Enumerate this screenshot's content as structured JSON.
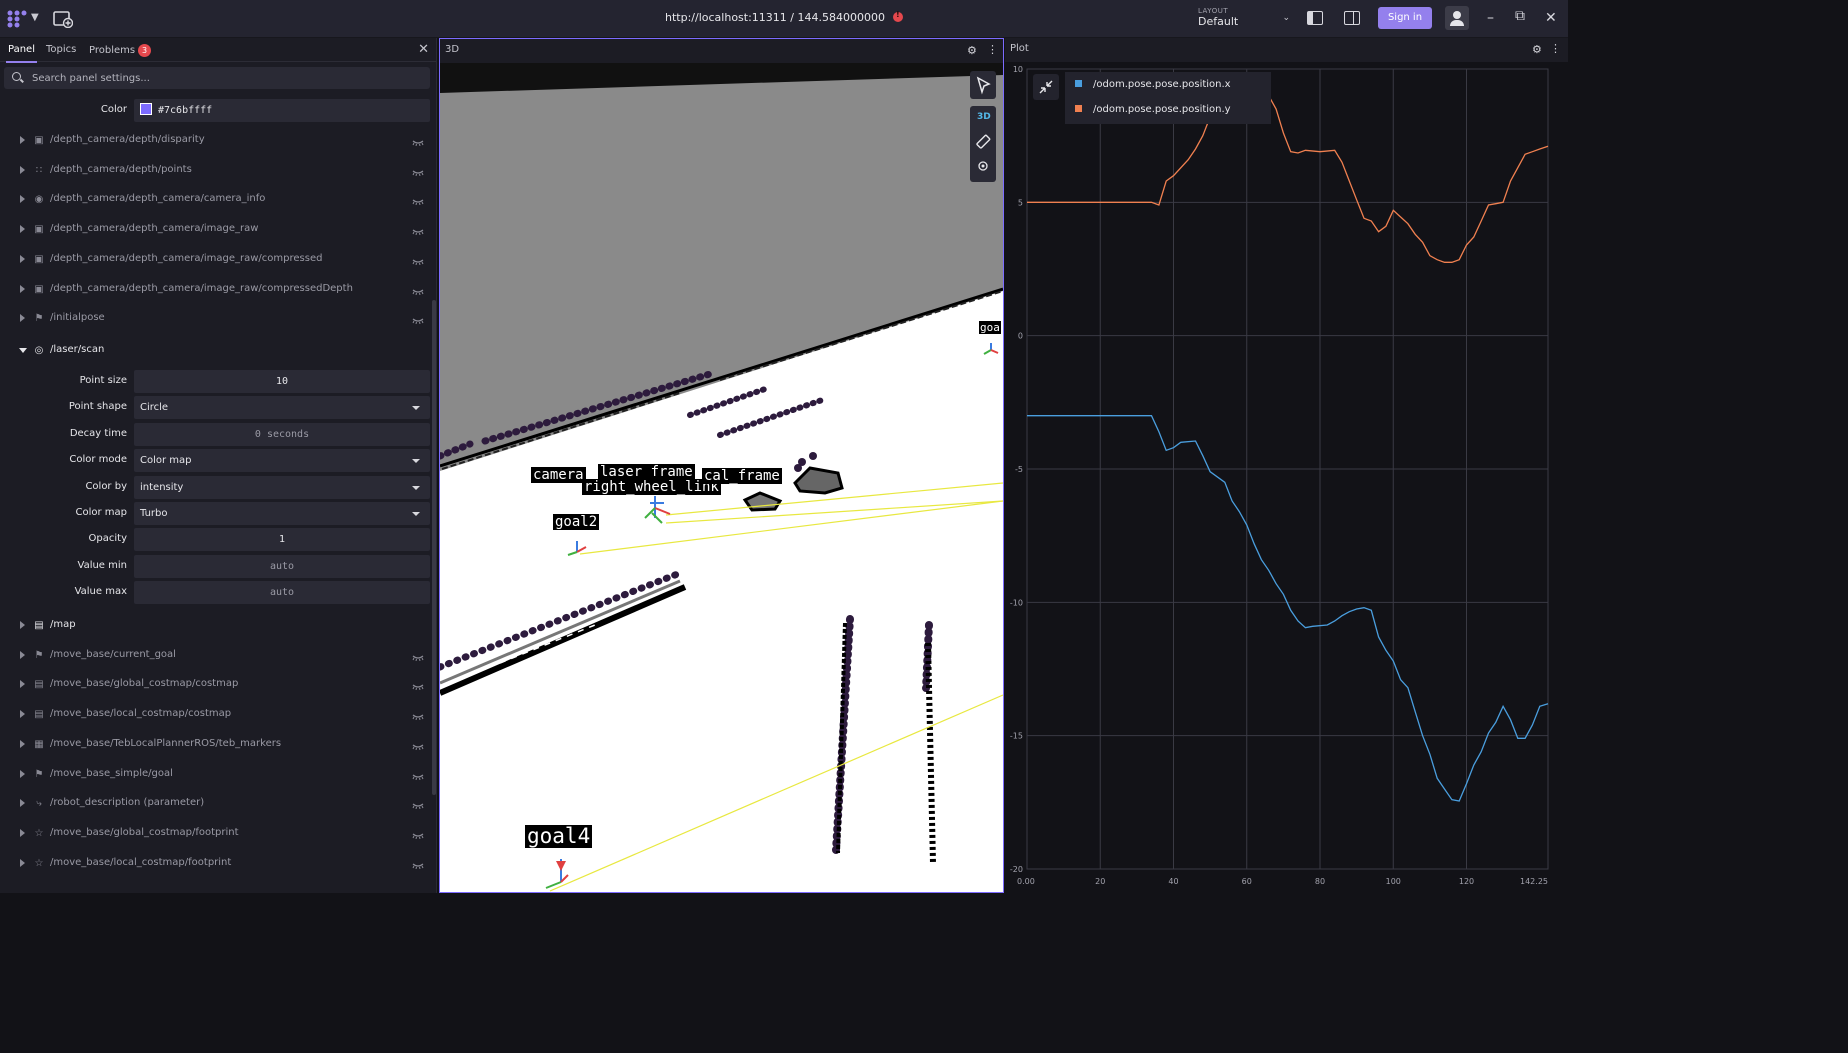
{
  "topbar": {
    "url": "http://localhost:11311 / 144.584000000",
    "layout_label": "LAYOUT",
    "layout_value": "Default",
    "signin": "Sign in"
  },
  "sidebar": {
    "tabs": [
      {
        "label": "Panel"
      },
      {
        "label": "Topics"
      },
      {
        "label": "Problems",
        "badge": "3"
      }
    ],
    "search_placeholder": "Search panel settings...",
    "color_field": {
      "label": "Color",
      "value": "#7c6bffff"
    },
    "topics_top": [
      {
        "name": "/depth_camera/depth/disparity",
        "icon": "image-icon"
      },
      {
        "name": "/depth_camera/depth/points",
        "icon": "points-icon"
      },
      {
        "name": "/depth_camera/depth_camera/camera_info",
        "icon": "camera-icon"
      },
      {
        "name": "/depth_camera/depth_camera/image_raw",
        "icon": "image-icon"
      },
      {
        "name": "/depth_camera/depth_camera/image_raw/compressed",
        "icon": "image-icon"
      },
      {
        "name": "/depth_camera/depth_camera/image_raw/compressedDepth",
        "icon": "image-icon"
      },
      {
        "name": "/initialpose",
        "icon": "flag-icon"
      }
    ],
    "laser": {
      "name": "/laser/scan",
      "fields": [
        {
          "label": "Point size",
          "value": "10",
          "kind": "number"
        },
        {
          "label": "Point shape",
          "value": "Circle",
          "kind": "select"
        },
        {
          "label": "Decay time",
          "value": "0 seconds",
          "kind": "muted"
        },
        {
          "label": "Color mode",
          "value": "Color map",
          "kind": "select"
        },
        {
          "label": "Color by",
          "value": "intensity",
          "kind": "select"
        },
        {
          "label": "Color map",
          "value": "Turbo",
          "kind": "select"
        },
        {
          "label": "Opacity",
          "value": "1",
          "kind": "number"
        },
        {
          "label": "Value min",
          "value": "auto",
          "kind": "muted"
        },
        {
          "label": "Value max",
          "value": "auto",
          "kind": "muted"
        }
      ]
    },
    "topics_bottom": [
      {
        "name": "/map",
        "icon": "grid-icon",
        "visible": true
      },
      {
        "name": "/move_base/current_goal",
        "icon": "flag-icon",
        "visible": false
      },
      {
        "name": "/move_base/global_costmap/costmap",
        "icon": "grid-icon",
        "visible": false
      },
      {
        "name": "/move_base/local_costmap/costmap",
        "icon": "grid-icon",
        "visible": false
      },
      {
        "name": "/move_base/TebLocalPlannerROS/teb_markers",
        "icon": "shapes-icon",
        "visible": false
      },
      {
        "name": "/move_base_simple/goal",
        "icon": "flag-icon",
        "visible": false
      },
      {
        "name": "/robot_description (parameter)",
        "icon": "robot-arm-icon",
        "visible": false
      },
      {
        "name": "/move_base/global_costmap/footprint",
        "icon": "star-icon",
        "visible": false
      },
      {
        "name": "/move_base/local_costmap/footprint",
        "icon": "star-icon",
        "visible": false
      }
    ]
  },
  "panel3d": {
    "title": "3D",
    "toolbar_3d_label": "3D",
    "labels": [
      "camera",
      "laser_frame",
      "right_wheel_link",
      "cal_frame",
      "goal2",
      "goal4",
      "goa"
    ]
  },
  "plot": {
    "title": "Plot",
    "legend": [
      {
        "name": "/odom.pose.pose.position.x",
        "color": "#4a9ede"
      },
      {
        "name": "/odom.pose.pose.position.y",
        "color": "#f08050"
      }
    ],
    "y_ticks": [
      "10",
      "5",
      "0",
      "-5",
      "-10",
      "-15",
      "-20"
    ],
    "x_ticks": [
      "0.00",
      "20",
      "40",
      "60",
      "80",
      "100",
      "120",
      "142.25"
    ]
  },
  "chart_data": {
    "type": "line",
    "xlim": [
      0,
      142.25
    ],
    "ylim": [
      -20,
      10
    ],
    "grid": true,
    "legend_position": "top-left",
    "series": [
      {
        "name": "/odom.pose.pose.position.x",
        "color": "#4a9ede",
        "x": [
          0,
          10,
          20,
          30,
          34,
          36,
          38,
          40,
          42,
          46,
          48,
          50,
          54,
          56,
          58,
          60,
          62,
          64,
          66,
          68,
          70,
          72,
          74,
          76,
          78,
          82,
          84,
          86,
          88,
          90,
          92,
          94,
          96,
          98,
          100,
          102,
          104,
          106,
          108,
          110,
          112,
          114,
          116,
          118,
          120,
          122,
          124,
          126,
          128,
          130,
          132,
          134,
          136,
          138,
          140,
          142.25
        ],
        "y": [
          -3.0,
          -3.0,
          -3.0,
          -3.0,
          -3.0,
          -3.6,
          -4.3,
          -4.2,
          -4.0,
          -3.95,
          -4.5,
          -5.1,
          -5.5,
          -6.2,
          -6.6,
          -7.1,
          -7.8,
          -8.4,
          -8.8,
          -9.3,
          -9.7,
          -10.3,
          -10.7,
          -10.95,
          -10.9,
          -10.85,
          -10.7,
          -10.5,
          -10.35,
          -10.25,
          -10.2,
          -10.3,
          -11.3,
          -11.8,
          -12.2,
          -12.9,
          -13.2,
          -14.1,
          -15.0,
          -15.7,
          -16.6,
          -17.0,
          -17.4,
          -17.45,
          -16.8,
          -16.1,
          -15.6,
          -14.9,
          -14.5,
          -13.9,
          -14.4,
          -15.1,
          -15.1,
          -14.6,
          -13.9,
          -13.8
        ]
      },
      {
        "name": "/odom.pose.pose.position.y",
        "color": "#f08050",
        "x": [
          0,
          10,
          20,
          30,
          34,
          36,
          38,
          40,
          44,
          46,
          48,
          50,
          52,
          54,
          56,
          58,
          60,
          62,
          64,
          66,
          68,
          70,
          72,
          74,
          76,
          80,
          84,
          86,
          88,
          90,
          92,
          94,
          96,
          98,
          100,
          102,
          104,
          106,
          108,
          110,
          112,
          114,
          116,
          118,
          120,
          122,
          124,
          126,
          128,
          130,
          132,
          134,
          136,
          138,
          140,
          142.25
        ],
        "y": [
          5.0,
          5.0,
          5.0,
          5.0,
          5.0,
          4.9,
          5.8,
          6.0,
          6.6,
          7.0,
          7.5,
          8.2,
          8.5,
          8.9,
          9.0,
          8.9,
          8.7,
          8.8,
          8.9,
          9.0,
          8.5,
          7.6,
          6.9,
          6.85,
          6.95,
          6.9,
          6.95,
          6.5,
          5.8,
          5.1,
          4.4,
          4.3,
          3.9,
          4.1,
          4.7,
          4.45,
          4.2,
          3.8,
          3.5,
          3.0,
          2.85,
          2.75,
          2.75,
          2.85,
          3.4,
          3.7,
          4.3,
          4.9,
          4.95,
          5.0,
          5.8,
          6.3,
          6.8,
          6.9,
          7.0,
          7.1
        ]
      }
    ]
  }
}
